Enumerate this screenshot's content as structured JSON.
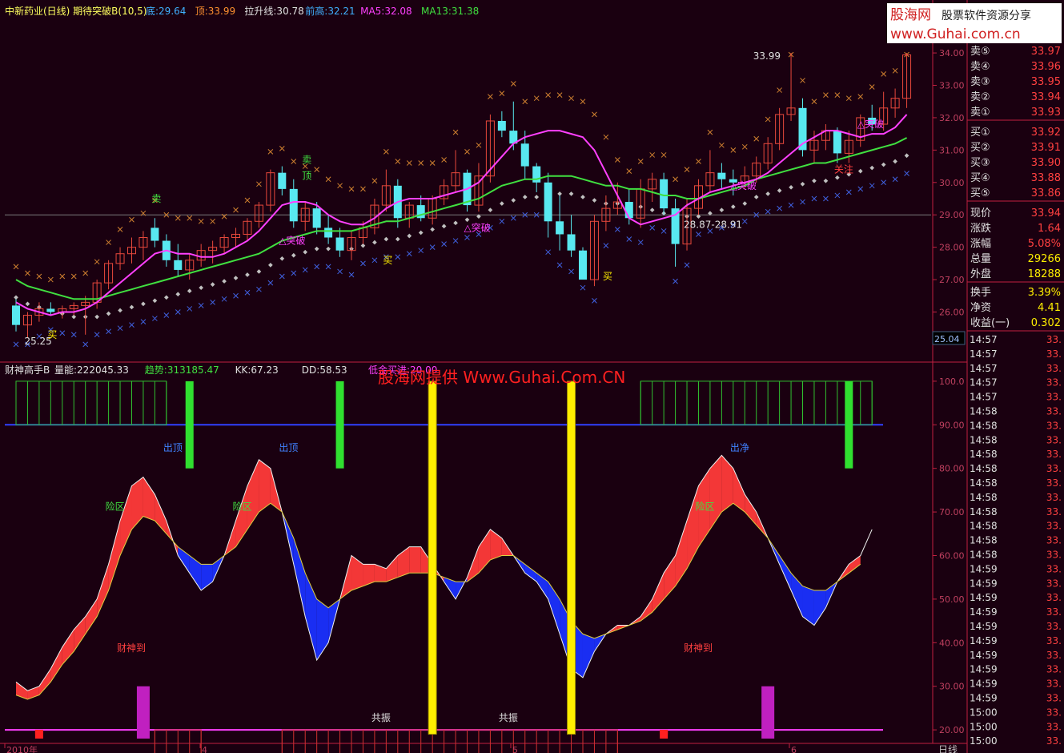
{
  "colors": {
    "bg": "#1a0010",
    "up": "#e8483c",
    "down": "#58e8f0",
    "ma5": "#ff40ff",
    "ma13": "#40e040",
    "grid": "#5a0020",
    "axis": "#c02040",
    "text": "#c0c0c0",
    "yellow": "#ffee00"
  },
  "top_header": {
    "title": "中新药业(日线) 期待突破B(10,5)",
    "items": [
      {
        "label": "底:29.64",
        "color": "#40b0ff"
      },
      {
        "label": "顶:33.99",
        "color": "#ff9030"
      },
      {
        "label": "拉升线:30.78",
        "color": "#e0e0e0"
      },
      {
        "label": "前高:32.21",
        "color": "#40b0ff"
      },
      {
        "label": "MA5:32.08",
        "color": "#ff40ff"
      },
      {
        "label": "MA13:31.38",
        "color": "#40e040"
      }
    ]
  },
  "bottom_header": {
    "title": "财神高手B",
    "items": [
      {
        "label": "量能:222045.33",
        "color": "#e0e0e0"
      },
      {
        "label": "趋势:313185.47",
        "color": "#40e040"
      },
      {
        "label": "KK:67.23",
        "color": "#e0e0e0"
      },
      {
        "label": "DD:58.53",
        "color": "#e0e0e0"
      },
      {
        "label": "低金买进:20.00",
        "color": "#ff40ff"
      }
    ]
  },
  "watermark_top": {
    "line1": "股海网",
    "line2": "股票软件资源分享",
    "line3": "www.Guhai.com.cn"
  },
  "watermark_mid": "股海网提供 Www.Guhai.Com.CN",
  "price_axis": [
    "34.00",
    "33.00",
    "32.00",
    "31.00",
    "30.00",
    "29.00",
    "28.00",
    "27.00",
    "26.00"
  ],
  "price_axis_marker": "25.04",
  "ind_axis": [
    "100.0",
    "90.00",
    "80.00",
    "70.00",
    "60.00",
    "50.00",
    "40.00",
    "30.00",
    "20.00"
  ],
  "x_axis": [
    "2010年",
    "4",
    "5",
    "6"
  ],
  "x_axis_right": "日线",
  "chart_data": [
    {
      "type": "candlestick",
      "title": "中新药业(日线)",
      "ylim": [
        24.8,
        34.2
      ],
      "candles": [
        [
          26.2,
          26.4,
          25.4,
          25.6
        ],
        [
          25.6,
          26.0,
          25.2,
          25.9
        ],
        [
          25.9,
          26.3,
          25.7,
          26.1
        ],
        [
          26.1,
          26.3,
          25.9,
          26.0
        ],
        [
          26.0,
          26.2,
          25.8,
          26.1
        ],
        [
          26.1,
          26.3,
          25.9,
          26.2
        ],
        [
          26.2,
          26.5,
          25.3,
          26.3
        ],
        [
          26.3,
          27.0,
          26.1,
          26.9
        ],
        [
          26.9,
          27.6,
          26.7,
          27.5
        ],
        [
          27.5,
          28.0,
          27.3,
          27.8
        ],
        [
          27.8,
          28.3,
          27.5,
          28.0
        ],
        [
          28.0,
          28.5,
          27.6,
          28.3
        ],
        [
          28.6,
          28.9,
          28.0,
          28.2
        ],
        [
          28.2,
          28.4,
          27.4,
          27.6
        ],
        [
          27.6,
          28.1,
          27.1,
          27.3
        ],
        [
          27.3,
          27.8,
          27.0,
          27.6
        ],
        [
          27.6,
          28.1,
          27.4,
          27.9
        ],
        [
          27.9,
          28.2,
          27.5,
          28.0
        ],
        [
          28.0,
          28.4,
          27.8,
          28.3
        ],
        [
          28.3,
          28.6,
          28.0,
          28.4
        ],
        [
          28.4,
          28.9,
          28.2,
          28.8
        ],
        [
          28.8,
          29.4,
          28.6,
          29.3
        ],
        [
          29.3,
          30.4,
          29.1,
          30.3
        ],
        [
          30.3,
          30.5,
          29.6,
          29.8
        ],
        [
          29.8,
          30.1,
          28.6,
          28.8
        ],
        [
          28.8,
          29.4,
          28.5,
          29.2
        ],
        [
          29.2,
          29.4,
          28.4,
          28.6
        ],
        [
          28.6,
          29.0,
          28.1,
          28.3
        ],
        [
          28.3,
          28.6,
          27.7,
          27.9
        ],
        [
          27.9,
          28.5,
          27.6,
          28.3
        ],
        [
          28.3,
          28.8,
          28.1,
          28.6
        ],
        [
          28.6,
          29.5,
          28.4,
          29.3
        ],
        [
          29.3,
          30.4,
          29.1,
          29.9
        ],
        [
          29.9,
          30.1,
          28.6,
          28.9
        ],
        [
          28.9,
          29.4,
          28.6,
          29.3
        ],
        [
          29.3,
          29.6,
          28.8,
          28.9
        ],
        [
          28.9,
          29.6,
          28.7,
          29.5
        ],
        [
          29.5,
          30.1,
          29.3,
          29.9
        ],
        [
          29.9,
          31.0,
          29.7,
          30.3
        ],
        [
          30.3,
          30.4,
          29.1,
          29.3
        ],
        [
          29.3,
          30.6,
          29.1,
          30.2
        ],
        [
          30.2,
          32.1,
          30.0,
          31.9
        ],
        [
          31.9,
          32.2,
          31.4,
          31.6
        ],
        [
          31.6,
          32.5,
          31.0,
          31.2
        ],
        [
          31.2,
          31.6,
          30.1,
          30.5
        ],
        [
          30.5,
          30.6,
          29.7,
          30.0
        ],
        [
          30.0,
          30.3,
          28.3,
          28.8
        ],
        [
          28.8,
          29.6,
          27.9,
          28.4
        ],
        [
          28.4,
          29.0,
          27.7,
          27.9
        ],
        [
          27.9,
          28.0,
          27.2,
          27.0
        ],
        [
          27.0,
          29.0,
          26.8,
          28.8
        ],
        [
          28.8,
          29.6,
          28.5,
          29.2
        ],
        [
          29.2,
          30.0,
          29.0,
          29.4
        ],
        [
          29.4,
          29.8,
          28.7,
          28.9
        ],
        [
          28.9,
          30.1,
          28.6,
          29.8
        ],
        [
          29.8,
          30.3,
          29.4,
          30.1
        ],
        [
          30.1,
          30.3,
          29.0,
          29.2
        ],
        [
          29.2,
          29.5,
          27.4,
          28.1
        ],
        [
          28.1,
          29.5,
          27.9,
          29.2
        ],
        [
          29.2,
          30.1,
          29.0,
          29.9
        ],
        [
          29.9,
          31.0,
          29.7,
          30.3
        ],
        [
          30.3,
          30.6,
          29.8,
          30.1
        ],
        [
          30.1,
          30.4,
          29.6,
          30.0
        ],
        [
          30.0,
          30.5,
          29.8,
          30.2
        ],
        [
          30.2,
          30.8,
          30.0,
          30.6
        ],
        [
          30.6,
          31.4,
          30.4,
          31.2
        ],
        [
          31.2,
          32.3,
          31.0,
          32.1
        ],
        [
          32.1,
          34.0,
          31.9,
          32.3
        ],
        [
          32.3,
          32.6,
          30.8,
          31.0
        ],
        [
          31.0,
          31.6,
          30.6,
          31.3
        ],
        [
          31.3,
          31.8,
          31.0,
          31.6
        ],
        [
          31.6,
          31.7,
          30.6,
          30.9
        ],
        [
          30.9,
          31.6,
          30.6,
          31.3
        ],
        [
          31.3,
          32.1,
          31.1,
          32.0
        ],
        [
          32.0,
          32.4,
          31.6,
          31.8
        ],
        [
          31.8,
          32.8,
          31.6,
          32.3
        ],
        [
          32.3,
          32.9,
          32.0,
          32.6
        ],
        [
          32.6,
          34.0,
          32.3,
          33.94
        ]
      ],
      "ma5": [
        26.3,
        26.1,
        26.0,
        25.9,
        26.0,
        26.0,
        26.1,
        26.3,
        26.6,
        26.9,
        27.2,
        27.5,
        27.8,
        27.9,
        27.8,
        27.8,
        27.7,
        27.7,
        27.8,
        28.0,
        28.2,
        28.5,
        28.9,
        29.3,
        29.4,
        29.4,
        29.3,
        29.0,
        28.8,
        28.7,
        28.7,
        28.9,
        29.2,
        29.4,
        29.5,
        29.5,
        29.5,
        29.6,
        29.7,
        29.8,
        30.0,
        30.4,
        30.8,
        31.2,
        31.4,
        31.5,
        31.6,
        31.6,
        31.5,
        31.4,
        31.0,
        30.3,
        29.6,
        28.9,
        28.7,
        28.8,
        28.9,
        29.0,
        29.3,
        29.5,
        29.7,
        29.8,
        29.9,
        30.0,
        30.1,
        30.3,
        30.6,
        30.9,
        31.2,
        31.4,
        31.6,
        31.6,
        31.5,
        31.4,
        31.5,
        31.5,
        31.7,
        32.1
      ],
      "ma13": [
        27.0,
        26.8,
        26.7,
        26.6,
        26.5,
        26.4,
        26.4,
        26.4,
        26.5,
        26.6,
        26.7,
        26.8,
        26.9,
        27.0,
        27.1,
        27.2,
        27.3,
        27.4,
        27.5,
        27.6,
        27.7,
        27.8,
        28.0,
        28.2,
        28.3,
        28.4,
        28.5,
        28.5,
        28.5,
        28.5,
        28.6,
        28.7,
        28.8,
        28.8,
        28.9,
        29.0,
        29.1,
        29.2,
        29.3,
        29.4,
        29.5,
        29.7,
        29.9,
        30.0,
        30.1,
        30.1,
        30.2,
        30.2,
        30.2,
        30.1,
        30.0,
        29.9,
        29.9,
        29.8,
        29.8,
        29.7,
        29.6,
        29.6,
        29.5,
        29.5,
        29.6,
        29.7,
        29.8,
        29.9,
        30.1,
        30.2,
        30.3,
        30.4,
        30.5,
        30.6,
        30.6,
        30.7,
        30.8,
        30.9,
        31.0,
        31.1,
        31.2,
        31.38
      ],
      "annotations": [
        {
          "i": 3,
          "y": 25.2,
          "text": "买",
          "color": "#ffee00"
        },
        {
          "i": 1,
          "y": 25.0,
          "text": "25.25",
          "color": "#e0e0e0"
        },
        {
          "i": 12,
          "y": 29.4,
          "text": "卖",
          "color": "#40e040"
        },
        {
          "i": 25,
          "y": 30.6,
          "text": "卖",
          "color": "#40e040"
        },
        {
          "i": 25,
          "y": 30.1,
          "text": "顶",
          "color": "#40e040"
        },
        {
          "i": 23,
          "y": 28.1,
          "text": "△突破",
          "color": "#ff40ff"
        },
        {
          "i": 32,
          "y": 27.5,
          "text": "买",
          "color": "#ffee00"
        },
        {
          "i": 39,
          "y": 28.5,
          "text": "△突破",
          "color": "#ff40ff"
        },
        {
          "i": 51,
          "y": 27.0,
          "text": "买",
          "color": "#ffee00"
        },
        {
          "i": 58,
          "y": 28.6,
          "text": "28.87-28.91",
          "color": "#e0e0e0"
        },
        {
          "i": 62,
          "y": 29.8,
          "text": "△突破",
          "color": "#ff40ff"
        },
        {
          "i": 64,
          "y": 33.8,
          "text": "33.99",
          "color": "#e0e0e0"
        },
        {
          "i": 71,
          "y": 30.3,
          "text": "关注",
          "color": "#ff4040"
        },
        {
          "i": 73,
          "y": 31.7,
          "text": "△突破",
          "color": "#ff40ff"
        }
      ]
    },
    {
      "type": "indicator",
      "title": "财神高手B",
      "ylim": [
        18,
        102
      ],
      "kk": [
        31,
        29,
        30,
        34,
        39,
        43,
        46,
        50,
        58,
        68,
        76,
        78,
        74,
        68,
        60,
        56,
        52,
        54,
        60,
        68,
        76,
        82,
        80,
        70,
        58,
        46,
        36,
        40,
        50,
        60,
        58,
        58,
        57,
        60,
        62,
        62,
        58,
        54,
        50,
        55,
        62,
        66,
        64,
        60,
        56,
        54,
        50,
        42,
        34,
        32,
        38,
        42,
        44,
        44,
        46,
        50,
        56,
        60,
        68,
        76,
        80,
        83,
        80,
        74,
        70,
        64,
        58,
        52,
        46,
        44,
        48,
        54,
        58,
        60,
        66
      ],
      "dd": [
        28,
        27,
        28,
        31,
        35,
        38,
        42,
        46,
        52,
        60,
        66,
        69,
        68,
        65,
        62,
        60,
        58,
        58,
        60,
        62,
        66,
        70,
        72,
        70,
        64,
        56,
        50,
        48,
        50,
        52,
        53,
        54,
        54,
        55,
        56,
        56,
        56,
        55,
        54,
        54,
        56,
        59,
        60,
        60,
        58,
        56,
        54,
        50,
        45,
        42,
        41,
        42,
        43,
        44,
        45,
        47,
        50,
        53,
        57,
        62,
        66,
        70,
        72,
        70,
        67,
        64,
        60,
        56,
        53,
        52,
        52,
        54,
        56,
        58
      ],
      "labels": [
        {
          "i": 8,
          "y": 70.5,
          "text": "险区",
          "color": "#40e040"
        },
        {
          "i": 19,
          "y": 70.5,
          "text": "险区",
          "color": "#40e040"
        },
        {
          "i": 59,
          "y": 70.5,
          "text": "险区",
          "color": "#40e040"
        },
        {
          "i": 9,
          "y": 38,
          "text": "财神到",
          "color": "#ff4040"
        },
        {
          "i": 58,
          "y": 38,
          "text": "财神到",
          "color": "#ff4040"
        },
        {
          "i": 31,
          "y": 22,
          "text": "共振",
          "color": "#e0e0e0"
        },
        {
          "i": 42,
          "y": 22,
          "text": "共振",
          "color": "#e0e0e0"
        },
        {
          "i": 13,
          "y": 84,
          "text": "出顶",
          "color": "#4080ff"
        },
        {
          "i": 23,
          "y": 84,
          "text": "出顶",
          "color": "#4080ff"
        },
        {
          "i": 62,
          "y": 84,
          "text": "出净",
          "color": "#4080ff"
        }
      ]
    }
  ],
  "quote_panel": {
    "asks": [
      {
        "label": "卖⑤",
        "price": "33.97"
      },
      {
        "label": "卖④",
        "price": "33.96"
      },
      {
        "label": "卖③",
        "price": "33.95"
      },
      {
        "label": "卖②",
        "price": "33.94"
      },
      {
        "label": "卖①",
        "price": "33.93"
      }
    ],
    "bids": [
      {
        "label": "买①",
        "price": "33.92"
      },
      {
        "label": "买②",
        "price": "33.91"
      },
      {
        "label": "买③",
        "price": "33.90"
      },
      {
        "label": "买④",
        "price": "33.88"
      },
      {
        "label": "买⑤",
        "price": "33.86"
      }
    ],
    "stats": [
      {
        "label": "现价",
        "value": "33.94",
        "color": "#ff4040"
      },
      {
        "label": "涨跌",
        "value": "1.64",
        "color": "#ff4040"
      },
      {
        "label": "涨幅",
        "value": "5.08%",
        "color": "#ff4040"
      },
      {
        "label": "总量",
        "value": "29266",
        "color": "#ffee00"
      },
      {
        "label": "外盘",
        "value": "18288",
        "color": "#ffee00"
      },
      {
        "label": "换手",
        "value": "3.39%",
        "color": "#ffee00"
      },
      {
        "label": "净资",
        "value": "4.41",
        "color": "#ffee00"
      },
      {
        "label": "收益(一)",
        "value": "0.302",
        "color": "#ffee00"
      }
    ],
    "ticks": [
      {
        "time": "14:57",
        "price": "33."
      },
      {
        "time": "14:57",
        "price": "33."
      },
      {
        "time": "14:57",
        "price": "33."
      },
      {
        "time": "14:57",
        "price": "33."
      },
      {
        "time": "14:57",
        "price": "33."
      },
      {
        "time": "14:58",
        "price": "33."
      },
      {
        "time": "14:58",
        "price": "33."
      },
      {
        "time": "14:58",
        "price": "33."
      },
      {
        "time": "14:58",
        "price": "33."
      },
      {
        "time": "14:58",
        "price": "33."
      },
      {
        "time": "14:58",
        "price": "33."
      },
      {
        "time": "14:58",
        "price": "33."
      },
      {
        "time": "14:58",
        "price": "33."
      },
      {
        "time": "14:58",
        "price": "33."
      },
      {
        "time": "14:58",
        "price": "33."
      },
      {
        "time": "14:58",
        "price": "33."
      },
      {
        "time": "14:59",
        "price": "33."
      },
      {
        "time": "14:59",
        "price": "33."
      },
      {
        "time": "14:59",
        "price": "33."
      },
      {
        "time": "14:59",
        "price": "33."
      },
      {
        "time": "14:59",
        "price": "33."
      },
      {
        "time": "14:59",
        "price": "33."
      },
      {
        "time": "14:59",
        "price": "33."
      },
      {
        "time": "14:59",
        "price": "33."
      },
      {
        "time": "14:59",
        "price": "33."
      },
      {
        "time": "14:59",
        "price": "33."
      },
      {
        "time": "15:00",
        "price": "33."
      },
      {
        "time": "15:00",
        "price": "33."
      },
      {
        "time": "15:00",
        "price": "33."
      }
    ]
  }
}
